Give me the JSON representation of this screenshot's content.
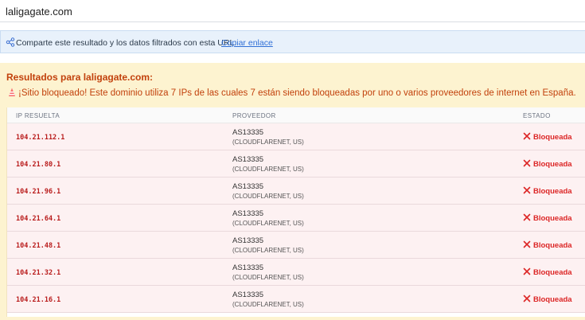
{
  "search": {
    "value": "laligagate.com"
  },
  "share": {
    "text": "Comparte este resultado y los datos filtrados con esta URL:",
    "link_label": "Copiar enlace",
    "icon": "share-icon"
  },
  "results": {
    "title": "Resultados para laligagate.com:",
    "alert": "¡Sitio bloqueado! Este dominio utiliza 7 IPs de las cuales 7 están siendo bloqueadas por uno o varios proveedores de internet en España.",
    "alert_icon": "warning-cone-icon"
  },
  "table": {
    "headers": {
      "ip": "IP RESUELTA",
      "provider": "PROVEEDOR",
      "status": "ESTADO"
    },
    "rows": [
      {
        "ip": "104.21.112.1",
        "asn": "AS13335",
        "org": "(CLOUDFLARENET, US)",
        "status": "Bloqueada"
      },
      {
        "ip": "104.21.80.1",
        "asn": "AS13335",
        "org": "(CLOUDFLARENET, US)",
        "status": "Bloqueada"
      },
      {
        "ip": "104.21.96.1",
        "asn": "AS13335",
        "org": "(CLOUDFLARENET, US)",
        "status": "Bloqueada"
      },
      {
        "ip": "104.21.64.1",
        "asn": "AS13335",
        "org": "(CLOUDFLARENET, US)",
        "status": "Bloqueada"
      },
      {
        "ip": "104.21.48.1",
        "asn": "AS13335",
        "org": "(CLOUDFLARENET, US)",
        "status": "Bloqueada"
      },
      {
        "ip": "104.21.32.1",
        "asn": "AS13335",
        "org": "(CLOUDFLARENET, US)",
        "status": "Bloqueada"
      },
      {
        "ip": "104.21.16.1",
        "asn": "AS13335",
        "org": "(CLOUDFLARENET, US)",
        "status": "Bloqueada"
      }
    ]
  },
  "colors": {
    "accent_orange": "#c2410c",
    "blocked_red": "#dc2626",
    "share_bg": "#e8f1fb",
    "results_bg": "#fdf3d0",
    "row_bg": "#fdf1f2"
  }
}
